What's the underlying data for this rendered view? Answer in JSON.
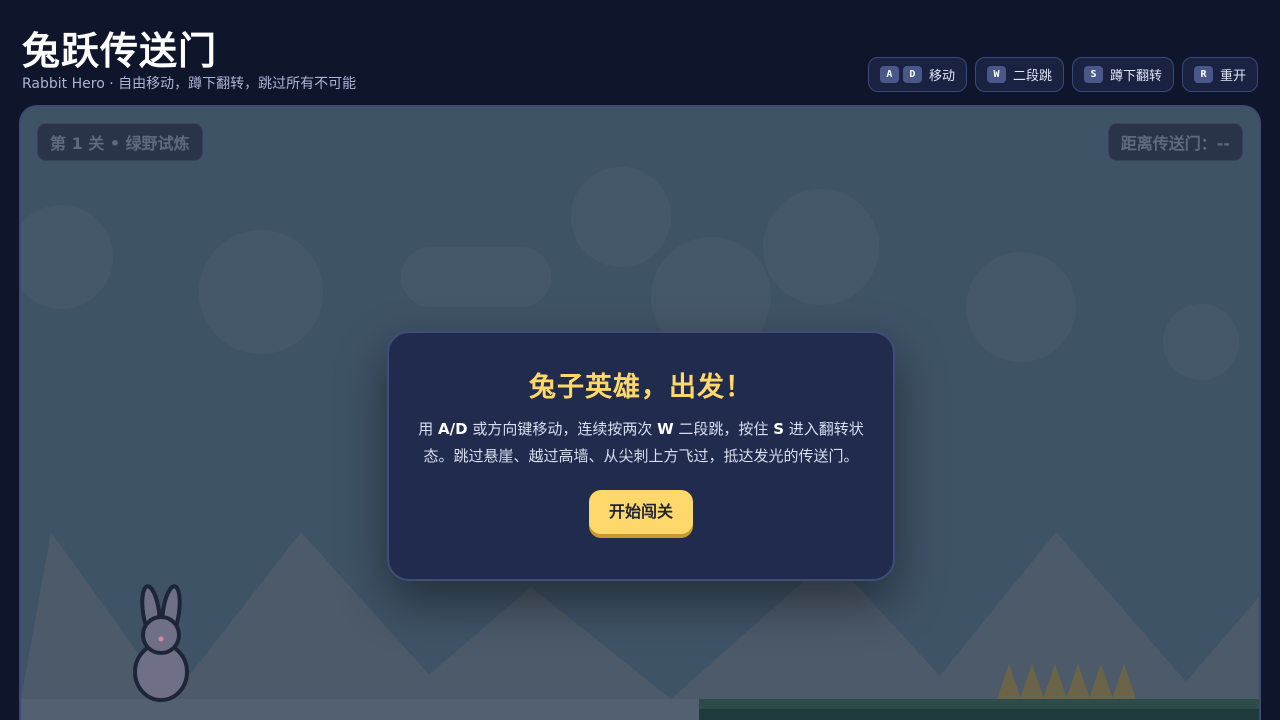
{
  "header": {
    "title": "兔跃传送门",
    "subtitle": "Rabbit Hero · 自由移动，蹲下翻转，跳过所有不可能"
  },
  "controls": [
    {
      "keys": [
        "A",
        "D"
      ],
      "label": "移动"
    },
    {
      "keys": [
        "W"
      ],
      "label": "二段跳"
    },
    {
      "keys": [
        "S"
      ],
      "label": "蹲下翻转"
    },
    {
      "keys": [
        "R"
      ],
      "label": "重开"
    }
  ],
  "hud": {
    "level": "第 1 关 • 绿野试炼",
    "distance": "距离传送门：--"
  },
  "modal": {
    "title": "兔子英雄，出发！",
    "body_parts": [
      {
        "t": "用 ",
        "b": false
      },
      {
        "t": "A/D",
        "b": true
      },
      {
        "t": " 或方向键移动，连续按两次 ",
        "b": false
      },
      {
        "t": "W",
        "b": true
      },
      {
        "t": " 二段跳，按住 ",
        "b": false
      },
      {
        "t": "S",
        "b": true
      },
      {
        "t": " 进入翻转状态。跳过悬崖、越过高墙、从尖刺上方飞过，抵达发光的传送门。",
        "b": false
      }
    ],
    "start_button": "开始闯关"
  },
  "colors": {
    "accent": "#ffd869",
    "button": "#ffd86b",
    "background": "#0f152b",
    "panel": "#212b4d"
  }
}
